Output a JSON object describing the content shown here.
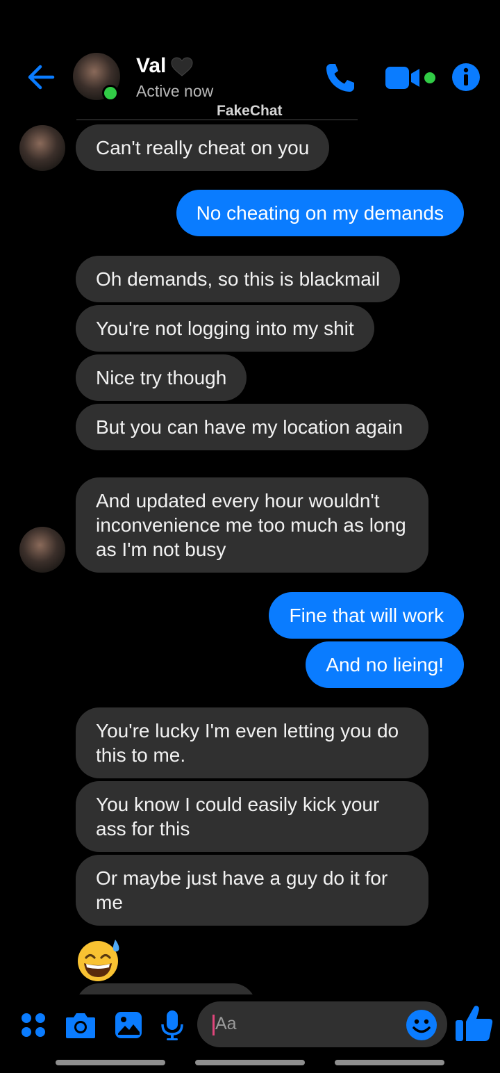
{
  "header": {
    "contact_name": "Val",
    "status": "Active now",
    "watermark": "FakeChat"
  },
  "icons": {
    "back": "back-arrow-icon",
    "call": "phone-icon",
    "video": "video-camera-icon",
    "info": "info-icon",
    "heart": "black-heart-emoji"
  },
  "colors": {
    "accent": "#0a7cff",
    "incoming_bubble": "#303030",
    "online": "#31cc46"
  },
  "messages": [
    {
      "from": "them",
      "text": "Can't really cheat on you"
    },
    {
      "from": "me",
      "text": "No cheating on my demands"
    },
    {
      "from": "them",
      "text": "Oh demands, so this is blackmail"
    },
    {
      "from": "them",
      "text": "You're not logging into my shit"
    },
    {
      "from": "them",
      "text": "Nice try though"
    },
    {
      "from": "them",
      "text": "But you can have my location again"
    },
    {
      "from": "them",
      "text": "And updated every hour wouldn't inconvenience me too much as long as I'm not busy"
    },
    {
      "from": "me",
      "text": "Fine that will work"
    },
    {
      "from": "me",
      "text": "And no lieing!"
    },
    {
      "from": "them",
      "text": "You're lucky I'm even letting you do this to me."
    },
    {
      "from": "them",
      "text": "You know I could easily kick your ass for this"
    },
    {
      "from": "them",
      "text": "Or maybe just have a guy do it for me"
    },
    {
      "from": "them",
      "text": "😅"
    }
  ],
  "composer": {
    "placeholder": "Aa"
  },
  "toolbar": {
    "more": "four-dots-icon",
    "camera": "camera-icon",
    "gallery": "image-icon",
    "mic": "microphone-icon",
    "emoji": "smiley-icon",
    "like": "thumbs-up-icon"
  }
}
